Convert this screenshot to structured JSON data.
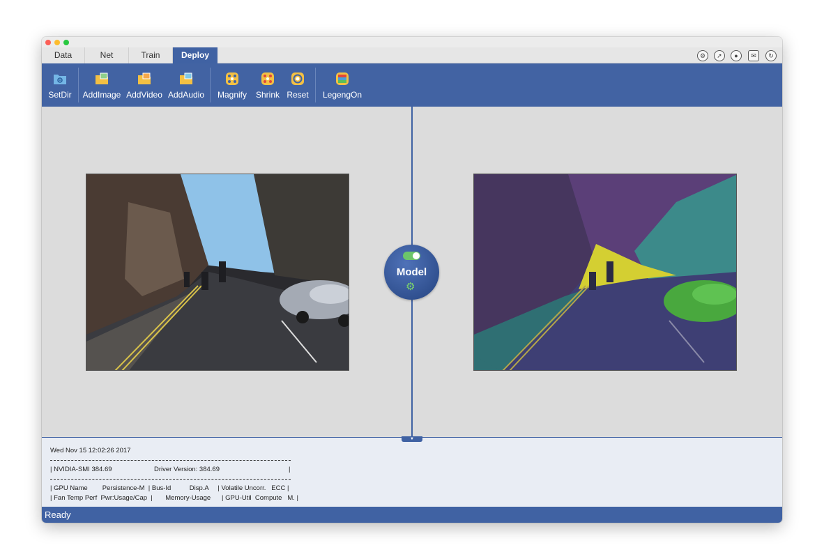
{
  "window": {
    "traffic_lights": [
      "#fc5f57",
      "#fdbc2e",
      "#28c840"
    ]
  },
  "tabs": [
    {
      "label": "Data",
      "active": false
    },
    {
      "label": "Net",
      "active": false
    },
    {
      "label": "Train",
      "active": false
    },
    {
      "label": "Deploy",
      "active": true
    }
  ],
  "header_icons": [
    "gear-icon",
    "compass-icon",
    "wechat-icon",
    "mail-icon",
    "refresh-icon"
  ],
  "toolbar": {
    "setdir": "SetDir",
    "addimage": "AddImage",
    "addvideo": "AddVideo",
    "addaudio": "AddAudio",
    "magnify": "Magnify",
    "shrink": "Shrink",
    "reset": "Reset",
    "legendon": "LegengOn"
  },
  "model_button": {
    "label": "Model",
    "toggle_on": true
  },
  "console": {
    "timestamp": "Wed Nov 15 12:02:26 2017",
    "line_smi": "| NVIDIA-SMI 384.69",
    "line_driver": "Driver Version: 384.69",
    "line_end": "|",
    "row1": "| GPU Name        Persistence-M  | Bus-Id          Disp.A     | Volatile Uncorr.   ECC |",
    "row2": "| Fan Temp Perf  Pwr:Usage/Cap  |       Memory-Usage      | GPU-Util  Compute   M. |"
  },
  "status": {
    "text": "Ready"
  },
  "colors": {
    "accent": "#4062a3",
    "toolbar": "#4263a3",
    "segmentation_road": "#3e3f74",
    "segmentation_sidewalk": "#2f6f73",
    "segmentation_car": "#49a83e",
    "segmentation_sign": "#d4cf32",
    "segmentation_sky": "#5b3f78",
    "segmentation_tree": "#3c8a8a"
  }
}
